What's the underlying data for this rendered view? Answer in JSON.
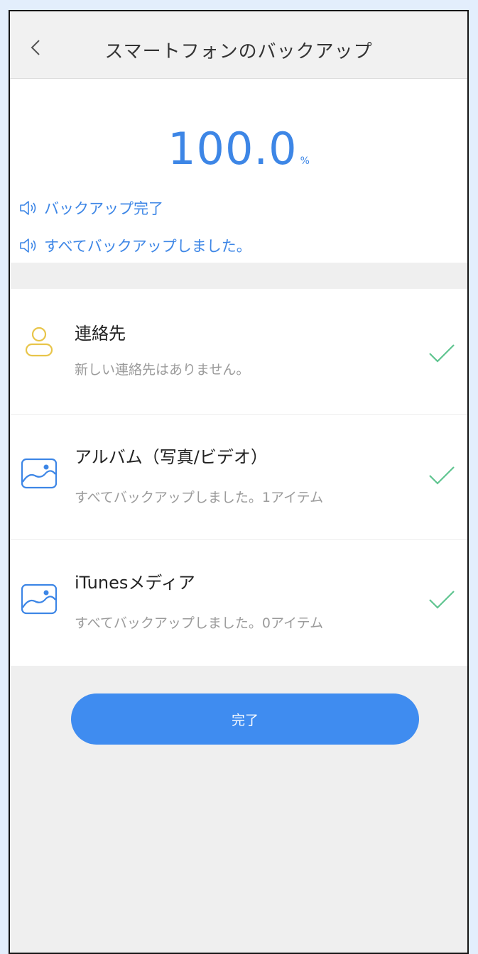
{
  "header": {
    "title": "スマートフォンのバックアップ",
    "back_icon": "chevron-left-icon"
  },
  "progress": {
    "value": "100.0",
    "unit": "%",
    "status_lines": [
      "バックアップ完了",
      "すべてバックアップしました。"
    ]
  },
  "items": [
    {
      "title": "連絡先",
      "subtitle": "新しい連絡先はありません。",
      "icon": "contact-person-icon",
      "status": "checkmark-icon"
    },
    {
      "title": "アルバム（写真/ビデオ）",
      "subtitle": "すべてバックアップしました。1アイテム",
      "icon": "photo-album-icon",
      "status": "checkmark-icon"
    },
    {
      "title": "iTunesメディア",
      "subtitle": "すべてバックアップしました。0アイテム",
      "icon": "photo-album-icon",
      "status": "checkmark-icon"
    }
  ],
  "done_button": {
    "label": "完了"
  },
  "colors": {
    "accent": "#3f8cf0",
    "percent_text": "#3d86e6",
    "check": "#5ec48f",
    "contact_icon": "#e8c54a",
    "album_icon": "#3d86e6"
  }
}
